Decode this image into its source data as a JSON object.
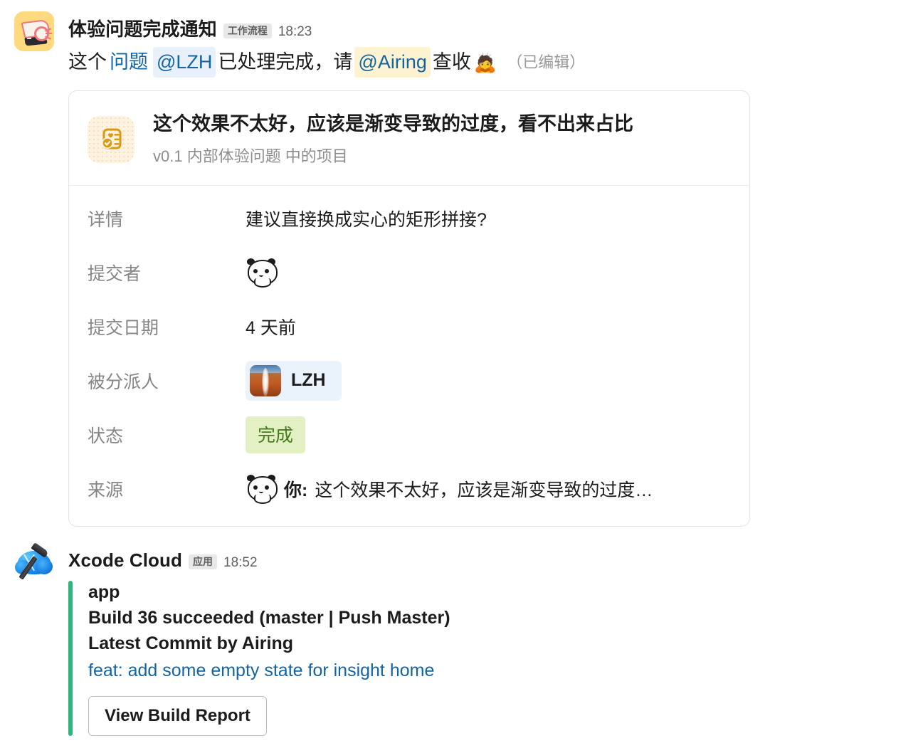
{
  "messages": [
    {
      "sender": "体验问题完成通知",
      "badge": "工作流程",
      "time": "18:23",
      "avatar_icon": "megaphone-icon",
      "text": {
        "pre": "这个",
        "link": "问题",
        "mention1": "@LZH",
        "mid": "已处理完成，请",
        "mention2": "@Airing",
        "post": "查收",
        "emoji": "🙇",
        "edited": "（已编辑）"
      },
      "card": {
        "icon": "clipboard-check-icon",
        "title": "这个效果不太好，应该是渐变导致的过度，看不出来占比",
        "subtitle": "v0.1 内部体验问题 中的项目",
        "fields": [
          {
            "label": "详情",
            "value": "建议直接换成实心的矩形拼接?",
            "kind": "text"
          },
          {
            "label": "提交者",
            "value": "",
            "kind": "panda-avatar"
          },
          {
            "label": "提交日期",
            "value": "4 天前",
            "kind": "text"
          },
          {
            "label": "被分派人",
            "value": "LZH",
            "kind": "assignee-chip"
          },
          {
            "label": "状态",
            "value": "完成",
            "kind": "status-badge"
          },
          {
            "label": "来源",
            "value": "这个效果不太好，应该是渐变导致的过度…",
            "prefix": "你:",
            "kind": "source"
          }
        ]
      }
    },
    {
      "sender": "Xcode Cloud",
      "badge": "应用",
      "time": "18:52",
      "avatar_icon": "xcode-cloud-icon",
      "attachment": {
        "app": "app",
        "build_status": "Build 36 succeeded (master | Push Master)",
        "commit_author": "Latest Commit by Airing",
        "commit_message": "feat: add some empty state for insight home",
        "button_label": "View Build Report",
        "bar_color": "#2eb67d"
      }
    }
  ],
  "colors": {
    "link": "#1264a3",
    "mention_bg": "#e8f1fb",
    "self_mention_bg": "#fdf3d1",
    "status_bg": "#e2f0c4",
    "status_text": "#477a1e",
    "green_bar": "#2eb67d"
  }
}
